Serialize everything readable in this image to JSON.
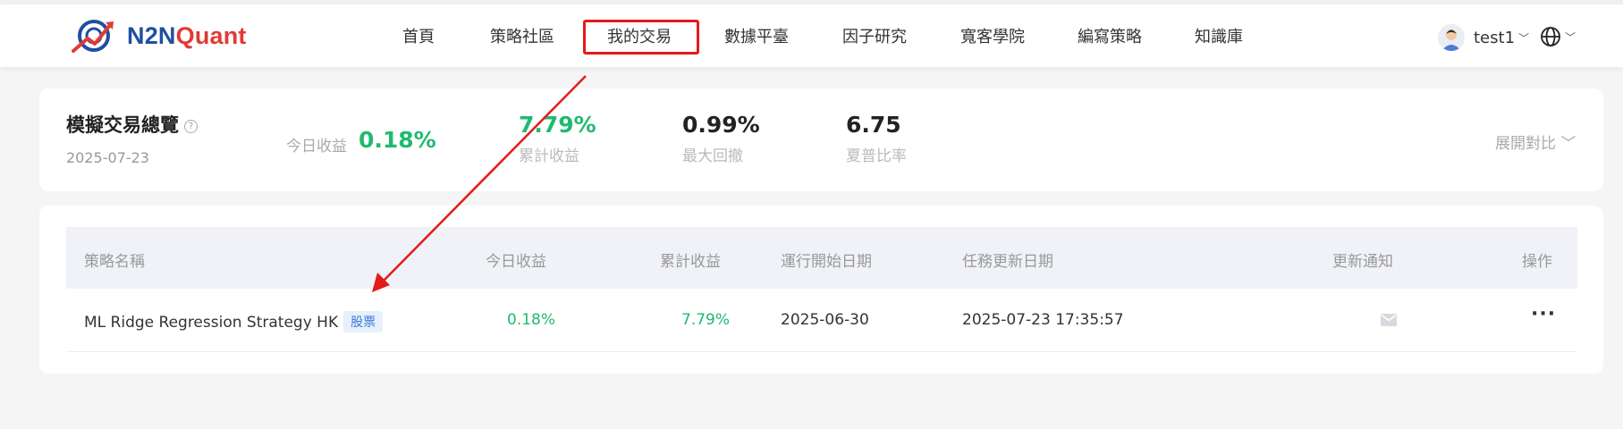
{
  "brand": {
    "logo_prefix": "N2N",
    "logo_suffix": "Quant"
  },
  "nav": {
    "items": [
      "首頁",
      "策略社區",
      "我的交易",
      "數據平臺",
      "因子研究",
      "寬客學院",
      "編寫策略",
      "知識庫"
    ],
    "active": "我的交易"
  },
  "user": {
    "name": "test1"
  },
  "overview": {
    "title": "模擬交易總覽",
    "date": "2025-07-23",
    "today_label": "今日收益",
    "today_value": "0.18%",
    "cumulative_value": "7.79%",
    "cumulative_label": "累計收益",
    "drawdown_value": "0.99%",
    "drawdown_label": "最大回撤",
    "sharpe_value": "6.75",
    "sharpe_label": "夏普比率",
    "expand_label": "展開對比"
  },
  "table": {
    "headers": {
      "name": "策略名稱",
      "today": "今日收益",
      "cumulative": "累計收益",
      "start_date": "運行開始日期",
      "update_date": "任務更新日期",
      "notify": "更新通知",
      "action": "操作"
    },
    "rows": [
      {
        "name": "ML Ridge Regression Strategy HK",
        "tag": "股票",
        "today": "0.18%",
        "cumulative": "7.79%",
        "start_date": "2025-06-30",
        "update_date": "2025-07-23 17:35:57",
        "action": "···"
      }
    ]
  },
  "colors": {
    "accent_green": "#1fba6f",
    "brand_blue": "#1f4fa0",
    "brand_red": "#e03a35",
    "annotation_red": "#e41b1b"
  },
  "icons": [
    "logo-icon",
    "avatar-icon",
    "chevron-down-icon",
    "globe-icon",
    "help-icon",
    "mail-icon",
    "more-icon"
  ]
}
